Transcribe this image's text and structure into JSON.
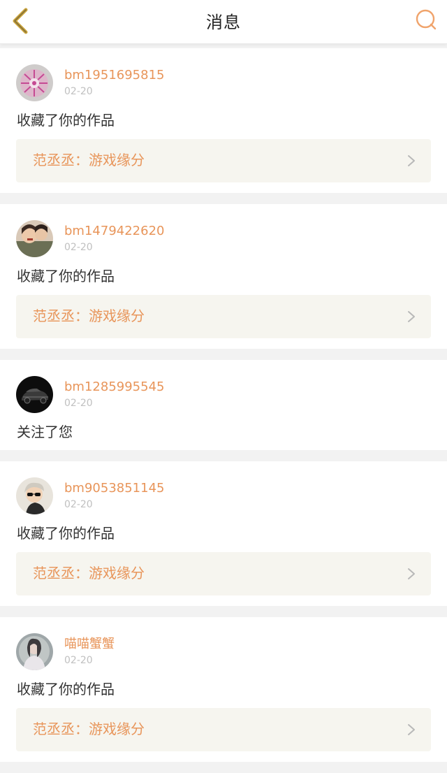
{
  "header": {
    "title": "消息",
    "back_icon": "chevron-left-icon",
    "search_icon": "search-icon"
  },
  "colors": {
    "accent": "#e8955a",
    "icon": "#c9a33a",
    "card_box": "#f6f5ef"
  },
  "messages": [
    {
      "username": "bm1951695815",
      "date": "02-20",
      "action": "收藏了你的作品",
      "work": "范丞丞：游戏缘分",
      "avatar": "flower-avatar"
    },
    {
      "username": "bm1479422620",
      "date": "02-20",
      "action": "收藏了你的作品",
      "work": "范丞丞：游戏缘分",
      "avatar": "two-women-avatar"
    },
    {
      "username": "bm1285995545",
      "date": "02-20",
      "action": "关注了您",
      "avatar": "car-avatar"
    },
    {
      "username": "bm9053851145",
      "date": "02-20",
      "action": "收藏了你的作品",
      "work": "范丞丞：游戏缘分",
      "avatar": "man-sunglasses-avatar"
    },
    {
      "username": "喵喵蟹蟹",
      "date": "02-20",
      "action": "收藏了你的作品",
      "work": "范丞丞：游戏缘分",
      "avatar": "woman-portrait-avatar"
    }
  ]
}
